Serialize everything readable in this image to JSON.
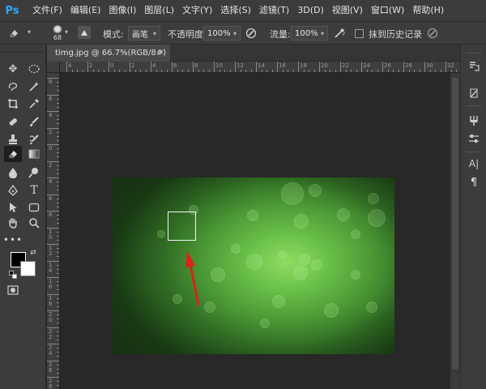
{
  "app": {
    "logo": "Ps"
  },
  "menu": [
    "文件(F)",
    "编辑(E)",
    "图像(I)",
    "图层(L)",
    "文字(Y)",
    "选择(S)",
    "滤镜(T)",
    "3D(D)",
    "视图(V)",
    "窗口(W)",
    "帮助(H)"
  ],
  "options": {
    "brush_size": "68",
    "mode_label": "模式:",
    "mode_value": "画笔",
    "opacity_label": "不透明度:",
    "opacity_value": "100%",
    "flow_label": "流量:",
    "flow_value": "100%",
    "history_label": "抹到历史记录"
  },
  "document": {
    "tab_title": "timg.jpg @ 66.7%(RGB/8#) *",
    "close_glyph": "×"
  },
  "ruler": {
    "top_labels": [
      "4",
      "2",
      "0",
      "2",
      "4",
      "6",
      "8",
      "10",
      "12",
      "14",
      "16",
      "18",
      "20",
      "22",
      "24",
      "26",
      "28",
      "30",
      "32"
    ],
    "left_labels": [
      "8",
      "6",
      "4",
      "2",
      "0",
      "2",
      "4",
      "6",
      "8",
      "1\n0",
      "1\n2",
      "1\n4",
      "1\n6",
      "1\n8",
      "2\n0",
      "2\n2",
      "2\n4",
      "2\n6",
      "2\n8"
    ]
  },
  "colors": {
    "menubar": "#3c3c3c",
    "workspace": "#282828",
    "accent_ps": "#31a8ff",
    "annotation_arrow": "#d8231d",
    "foreground": "#000000",
    "background": "#ffffff"
  },
  "icons": {
    "toolbar": [
      "move-icon",
      "elliptical-marquee-icon",
      "lasso-icon",
      "magic-wand-icon",
      "crop-icon",
      "eyedropper-icon",
      "healing-brush-icon",
      "brush-icon",
      "clone-stamp-icon",
      "history-brush-icon",
      "eraser-icon",
      "gradient-icon",
      "blur-icon",
      "dodge-icon",
      "pen-icon",
      "type-icon",
      "path-selection-icon",
      "rectangle-shape-icon",
      "hand-icon",
      "zoom-icon",
      "more-tools-icon",
      "quick-mask-icon"
    ],
    "right_dock": [
      "history-panel-icon",
      "tool-presets-icon",
      "brush-settings-icon",
      "adjustments-icon",
      "character-icon",
      "paragraph-icon"
    ]
  }
}
